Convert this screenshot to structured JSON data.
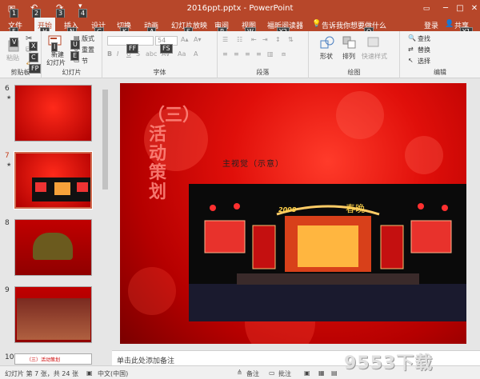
{
  "titlebar": {
    "title": "2016ppt.pptx - PowerPoint",
    "keytips": [
      "1",
      "2",
      "3",
      "4"
    ],
    "window_buttons": [
      "─",
      "□",
      "✕"
    ]
  },
  "tabs": [
    {
      "label": "文件",
      "keytip": "F"
    },
    {
      "label": "开始",
      "keytip": "H",
      "active": true
    },
    {
      "label": "插入",
      "keytip": "N"
    },
    {
      "label": "设计",
      "keytip": "G"
    },
    {
      "label": "切换",
      "keytip": "K"
    },
    {
      "label": "动画",
      "keytip": "A"
    },
    {
      "label": "幻灯片放映",
      "keytip": "S"
    },
    {
      "label": "审阅",
      "keytip": "R"
    },
    {
      "label": "视图",
      "keytip": "W"
    },
    {
      "label": "福昕阅读器",
      "keytip": "Y2"
    }
  ],
  "tell_me": {
    "text": "告诉我你想要做什么",
    "keytip": "Q"
  },
  "account": {
    "login": "登录",
    "share": "共享",
    "share_keytip": "Y1"
  },
  "ribbon": {
    "clipboard": {
      "label": "剪贴板",
      "paste": "粘贴",
      "keytips": [
        "V",
        "X",
        "C",
        "FP"
      ]
    },
    "slides": {
      "label": "幻灯片",
      "new_slide": "新建",
      "new_slide2": "幻灯片",
      "layout": "版式",
      "reset": "重置",
      "section": "节",
      "keytips": [
        "I",
        "U",
        "E"
      ]
    },
    "font": {
      "label": "字体",
      "size": "54",
      "keytips": [
        "FF",
        "FS"
      ]
    },
    "paragraph": {
      "label": "段落"
    },
    "drawing": {
      "label": "绘图",
      "shape": "形状",
      "arrange": "排列",
      "quick_style": "快速样式"
    },
    "editing": {
      "label": "编辑",
      "find": "查找",
      "replace": "替换",
      "select": "选择"
    }
  },
  "slides": [
    {
      "num": "6",
      "star": "★"
    },
    {
      "num": "7",
      "star": "★",
      "selected": true
    },
    {
      "num": "8"
    },
    {
      "num": "9"
    },
    {
      "num": "10",
      "caption": "（三）活动策划"
    }
  ],
  "slide": {
    "vertical_title": "（三）活动策划",
    "subheading": "主视觉（示意）",
    "stage_year": "2008",
    "stage_text": "春晚"
  },
  "notes": {
    "placeholder": "单击此处添加备注"
  },
  "status": {
    "slide_info": "幻灯片 第 7 张，共 24 张",
    "language": "中文(中国)",
    "notes_btn": "备注",
    "comments_btn": "批注"
  },
  "watermark": "9553下载",
  "colors": {
    "accent": "#b7472a",
    "slide_red": "#e00f0a"
  }
}
